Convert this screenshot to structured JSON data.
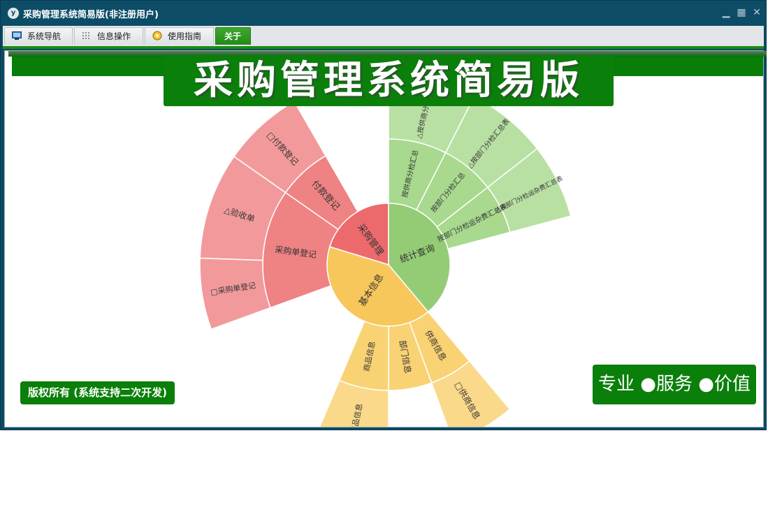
{
  "window": {
    "title": "采购管理系统简易版(非注册用户)",
    "app_icon": "y"
  },
  "window_controls": {
    "minimize_icon": "minimize-icon",
    "restore_icon": "restore-icon",
    "close_icon": "close-icon"
  },
  "menu": {
    "tabs": [
      {
        "label": "系统导航",
        "icon": "monitor-icon"
      },
      {
        "label": "信息操作",
        "icon": "grid-icon"
      },
      {
        "label": "使用指南",
        "icon": "lightbulb-icon"
      },
      {
        "label": "关于",
        "active": true
      }
    ]
  },
  "banner": {
    "title": "采购管理系统简易版"
  },
  "footer": {
    "copyright": "版权所有 (系统支持二次开发)",
    "slogan": "专业 ●服务 ●价值"
  },
  "colors": {
    "title_bar": "#0d4c66",
    "accent_green": "#0a7f0a",
    "red": "#ec6a6c",
    "green": "#93cc75",
    "yellow": "#f8c75b"
  },
  "sunburst": {
    "center": [
      {
        "label": "采购管理",
        "color": "#ec6a6c"
      },
      {
        "label": "统计查询",
        "color": "#93cc75"
      },
      {
        "label": "基本信息",
        "color": "#f8c75b"
      }
    ],
    "ring2": [
      {
        "label": "付款登记",
        "color": "#ef8283"
      },
      {
        "label": "采购单登记",
        "color": "#ef8283"
      },
      {
        "label": "按供商分检汇总",
        "color": "#a8d98e"
      },
      {
        "label": "按部门分检汇总",
        "color": "#a8d98e"
      },
      {
        "label": "按部门分检运杂费汇总表",
        "color": "#a8d98e"
      },
      {
        "label": "供商信息",
        "color": "#f9d274"
      },
      {
        "label": "部门信息",
        "color": "#f9d274"
      },
      {
        "label": "商品信息",
        "color": "#f9d274"
      }
    ],
    "ring3": [
      {
        "label": "□付款登记",
        "color": "#f29a9b"
      },
      {
        "label": "△验收单",
        "color": "#f29a9b"
      },
      {
        "label": "□采购单登记",
        "color": "#f29a9b"
      },
      {
        "label": "△按供商分检汇总",
        "color": "#b9e0a3"
      },
      {
        "label": "△按部门分检汇总表",
        "color": "#b9e0a3"
      },
      {
        "label": "△按部门分检运杂费汇总表",
        "color": "#b9e0a3"
      },
      {
        "label": "□供商信息",
        "color": "#fad98b"
      },
      {
        "label": "商品信息",
        "color": "#fad98b"
      }
    ]
  }
}
